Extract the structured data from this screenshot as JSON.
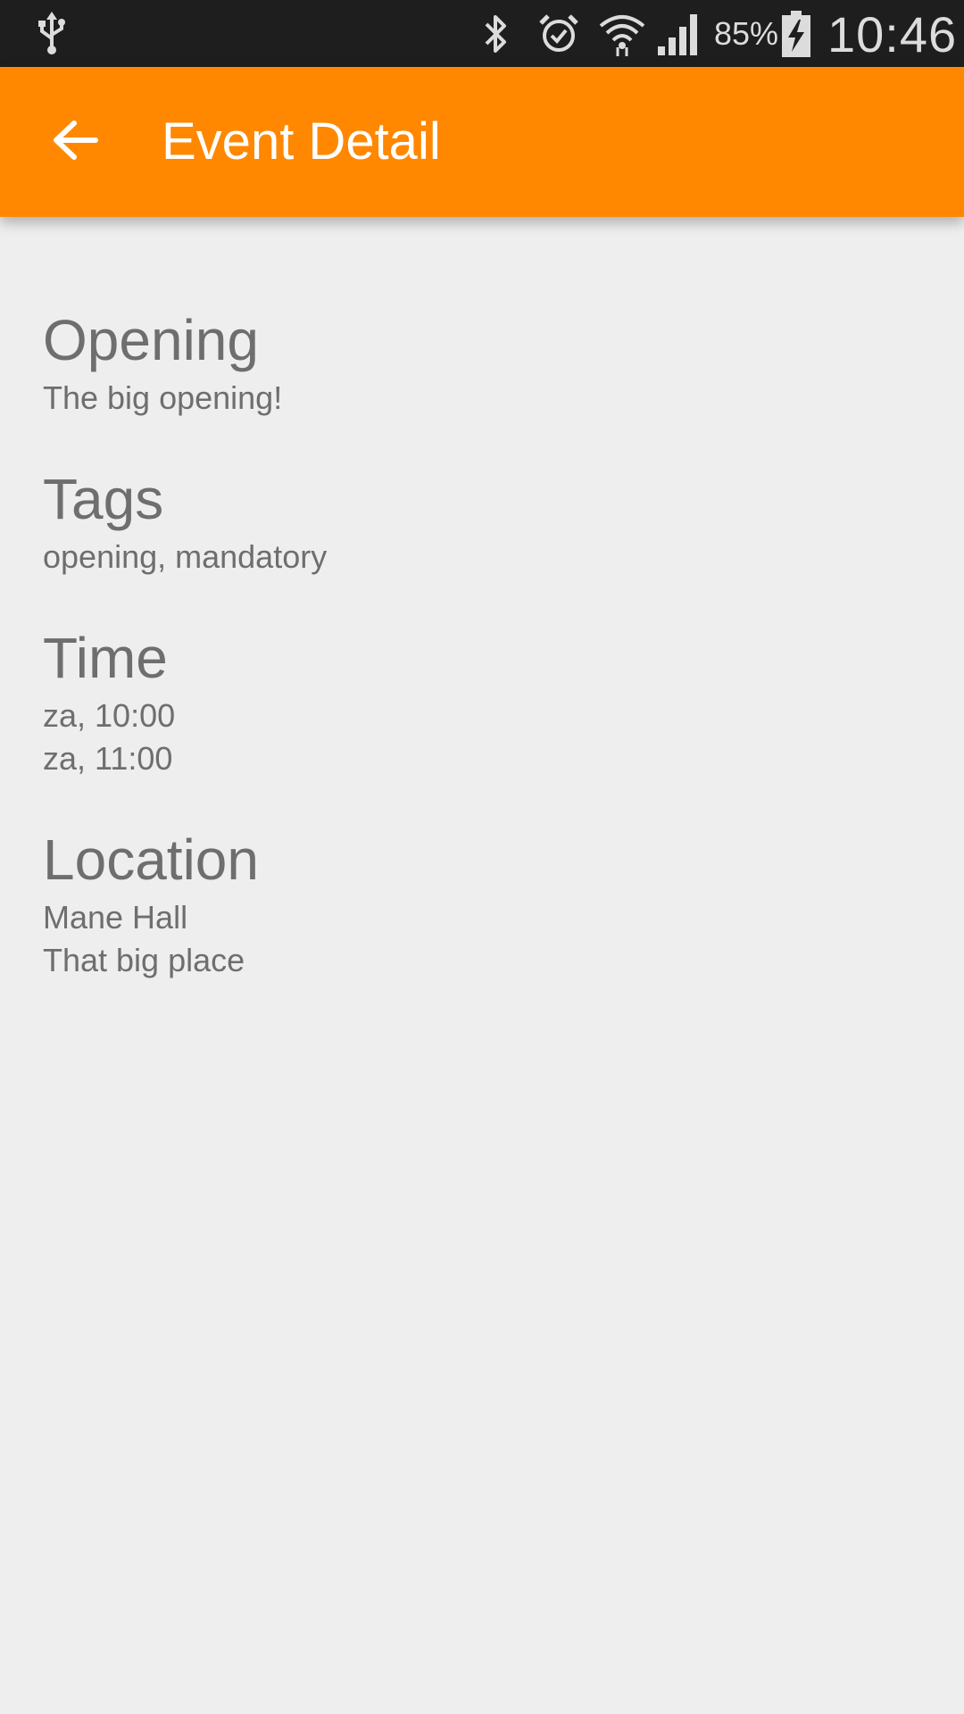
{
  "status_bar": {
    "icons": [
      "usb-icon",
      "bluetooth-icon",
      "alarm-icon",
      "wifi-icon",
      "signal-icon",
      "battery-charging-icon"
    ],
    "battery_percent": "85%",
    "time": "10:46"
  },
  "app_bar": {
    "title": "Event Detail",
    "back_icon": "arrow-back-icon",
    "color": "#ff8800"
  },
  "event": {
    "title": "Opening",
    "description": "The big opening!",
    "tags_heading": "Tags",
    "tags": "opening, mandatory",
    "time_heading": "Time",
    "start_time": "za, 10:00",
    "end_time": "za, 11:00",
    "location_heading": "Location",
    "location_name": "Mane Hall",
    "location_description": "That big place"
  },
  "colors": {
    "status_bar": "#1e1e1e",
    "background": "#eeeeee",
    "text": "#6e6e6e"
  }
}
